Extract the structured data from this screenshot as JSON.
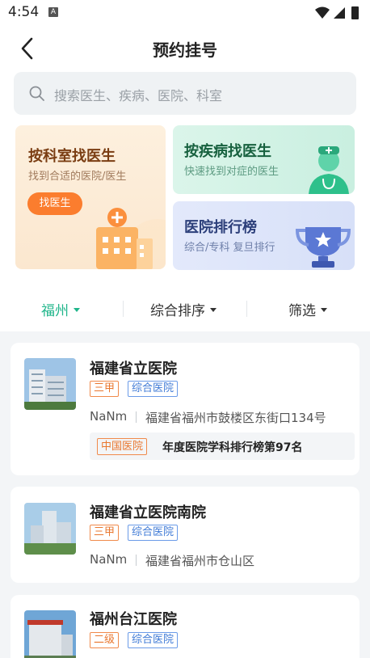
{
  "status_bar": {
    "time": "4:54",
    "notif_letter": "A"
  },
  "header": {
    "title": "预约挂号"
  },
  "search": {
    "placeholder": "搜索医生、疾病、医院、科室"
  },
  "quick_cards": {
    "dept": {
      "title": "按科室找医生",
      "subtitle": "找到合适的医院/医生",
      "button": "找医生"
    },
    "disease": {
      "title": "按疾病找医生",
      "subtitle": "快速找到对症的医生"
    },
    "ranking": {
      "title": "医院排行榜",
      "subtitle": "综合/专科 复旦排行"
    }
  },
  "filters": {
    "city": "福州",
    "sort": "综合排序",
    "filter": "筛选"
  },
  "colors": {
    "accent": "#1fb58a",
    "orange": "#fb7d2e"
  },
  "hospitals": [
    {
      "name": "福建省立医院",
      "grade": "三甲",
      "type": "综合医院",
      "distance": "NaNm",
      "address": "福建省福州市鼓楼区东街口134号",
      "rank_tag": "中国医院",
      "rank_text": "年度医院学科排行榜第97名"
    },
    {
      "name": "福建省立医院南院",
      "grade": "三甲",
      "type": "综合医院",
      "distance": "NaNm",
      "address": "福建省福州市仓山区"
    },
    {
      "name": "福州台江医院",
      "grade": "二级",
      "type": "综合医院"
    }
  ]
}
